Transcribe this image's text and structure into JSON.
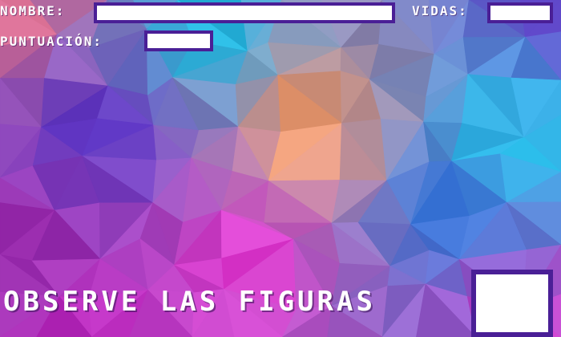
{
  "hud": {
    "name_label": "NOMBRE:",
    "name_value": "",
    "lives_label": "ViDAS:",
    "lives_value": "",
    "score_label": "PUNTUACiÓN:",
    "score_value": ""
  },
  "prompt": {
    "text": "OBSERVE LAS FiGURAS"
  },
  "figure_display": {
    "value": ""
  },
  "colors": {
    "field_border": "#4a1f96",
    "field_fill": "#ffffff",
    "label_text": "#ffffff"
  }
}
